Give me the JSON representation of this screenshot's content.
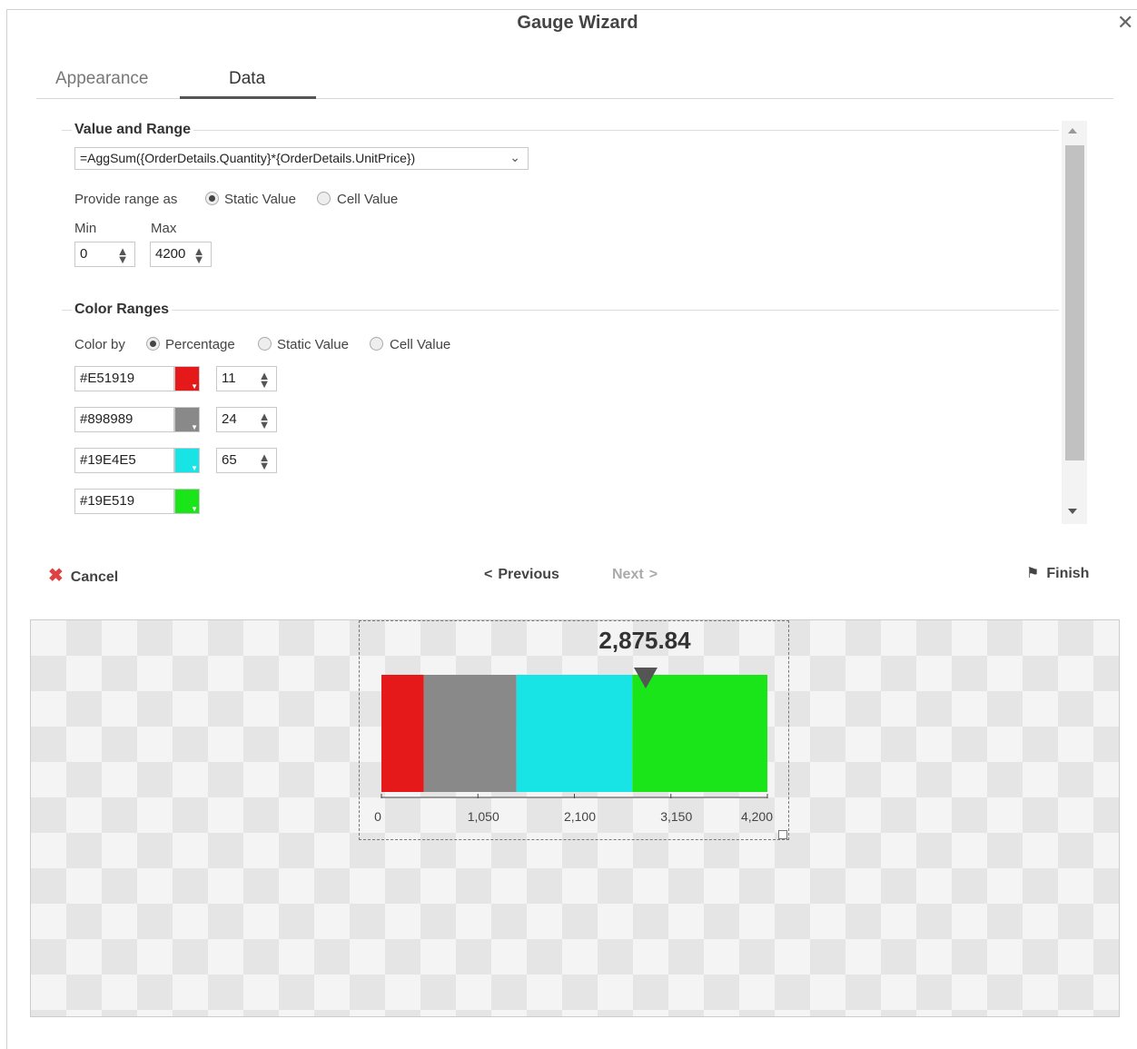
{
  "dialog": {
    "title": "Gauge Wizard"
  },
  "tabs": [
    {
      "label": "Appearance"
    },
    {
      "label": "Data"
    }
  ],
  "value_range": {
    "section_title": "Value and Range",
    "expression": "=AggSum({OrderDetails.Quantity}*{OrderDetails.UnitPrice})",
    "provide_range_label": "Provide range as",
    "range_options": [
      {
        "label": "Static Value",
        "selected": true
      },
      {
        "label": "Cell Value",
        "selected": false
      }
    ],
    "min_label": "Min",
    "max_label": "Max",
    "min_value": "0",
    "max_value": "4200"
  },
  "color_ranges": {
    "section_title": "Color Ranges",
    "color_by_label": "Color by",
    "color_by_options": [
      {
        "label": "Percentage",
        "selected": true
      },
      {
        "label": "Static Value",
        "selected": false
      },
      {
        "label": "Cell Value",
        "selected": false
      }
    ],
    "ranges": [
      {
        "hex": "#E51919",
        "color": "#E51919",
        "value": "11"
      },
      {
        "hex": "#898989",
        "color": "#898989",
        "value": "24"
      },
      {
        "hex": "#19E4E5",
        "color": "#19E4E5",
        "value": "65"
      },
      {
        "hex": "#19E519",
        "color": "#19E519",
        "value": ""
      }
    ]
  },
  "buttons": {
    "cancel": "Cancel",
    "previous": "Previous",
    "next": "Next",
    "finish": "Finish"
  },
  "icons": {
    "close": "close-icon",
    "cancel": "x-icon",
    "previous": "chevron-left-icon",
    "next": "chevron-right-icon",
    "finish": "checkered-flag-icon"
  },
  "chart_data": {
    "type": "bar",
    "subtype": "linear-gauge",
    "value": 2875.84,
    "value_label": "2,875.84",
    "min": 0,
    "max": 4200,
    "ticks": [
      0,
      1050,
      2100,
      3150,
      4200
    ],
    "tick_labels": [
      "0",
      "1,050",
      "2,100",
      "3,150",
      "4,200"
    ],
    "bands": [
      {
        "from": 0,
        "to": 462,
        "color": "#E51919"
      },
      {
        "from": 462,
        "to": 1470,
        "color": "#898989"
      },
      {
        "from": 1470,
        "to": 2730,
        "color": "#19E4E5"
      },
      {
        "from": 2730,
        "to": 4200,
        "color": "#19E519"
      }
    ]
  }
}
